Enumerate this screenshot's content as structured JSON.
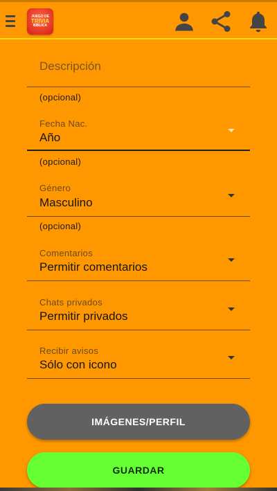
{
  "header": {
    "logo": {
      "line1": "JUEGO DE",
      "line2": "TRIVIA",
      "line3": "BÍBLICA"
    },
    "icons": [
      "menu-icon",
      "profile-icon",
      "share-icon",
      "bell-icon"
    ]
  },
  "form": {
    "descripcion": {
      "placeholder": "Descripción",
      "helper": "(opcional)"
    },
    "fecha": {
      "label": "Fecha Nac.",
      "value": "Año",
      "helper": "(opcional)"
    },
    "genero": {
      "label": "Género",
      "value": "Masculino",
      "helper": "(opcional)"
    },
    "comentarios": {
      "label": "Comentarios",
      "value": "Permitir comentarios"
    },
    "chats": {
      "label": "Chats privados",
      "value": "Permitir privados"
    },
    "avisos": {
      "label": "Recibir avisos",
      "value": "Sólo con icono"
    }
  },
  "buttons": {
    "images_label": "IMÁGENES/PERFIL",
    "save_label": "GUARDAR"
  },
  "colors": {
    "background": "#FF9800",
    "accent_line": "#FFE100",
    "save_button": "#66FF33",
    "images_button": "#616161"
  }
}
